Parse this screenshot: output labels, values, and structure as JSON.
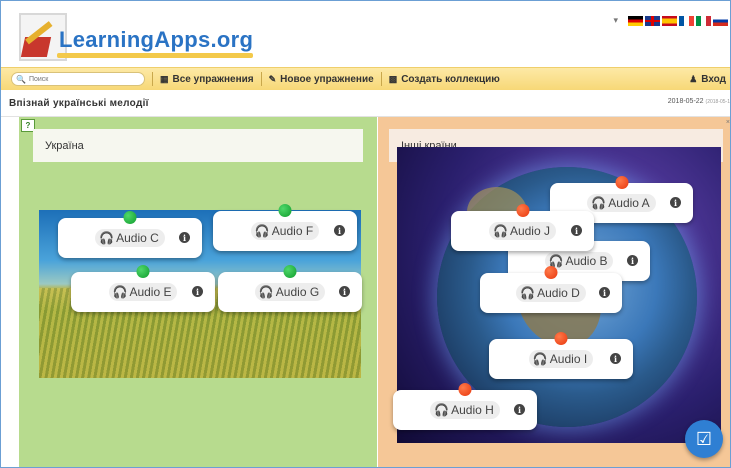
{
  "app": {
    "logo_text": "LearningApps.org",
    "lang_arrow": "▾",
    "languages": [
      "de",
      "gb",
      "es",
      "fr",
      "it",
      "ru"
    ]
  },
  "nav": {
    "search_placeholder": "Поиск",
    "all_exercises": "Все упражнения",
    "new_exercise": "Новое упражнение",
    "create_collection": "Создать коллекцию",
    "login": "Вход"
  },
  "page": {
    "title": "Впізнай українські мелодії",
    "date": "2018-05-22",
    "date_small": "(2018-05-1"
  },
  "categories": {
    "left": "Україна",
    "right": "Інші країни"
  },
  "cards": [
    {
      "label": "Audio C",
      "pin": "green"
    },
    {
      "label": "Audio F",
      "pin": "green"
    },
    {
      "label": "Audio E",
      "pin": "green"
    },
    {
      "label": "Audio G",
      "pin": "green"
    },
    {
      "label": "Audio A",
      "pin": "red"
    },
    {
      "label": "Audio J",
      "pin": "red"
    },
    {
      "label": "Audio B",
      "pin": "none"
    },
    {
      "label": "Audio D",
      "pin": "red"
    },
    {
      "label": "Audio I",
      "pin": "red"
    },
    {
      "label": "Audio H",
      "pin": "red"
    }
  ],
  "colors": {
    "left_panel": "#b7db8e",
    "right_panel": "#f5c797",
    "pin_green": "#1aa83a",
    "pin_red": "#f24b1a",
    "check_button": "#2f7fd3",
    "logo_blue": "#2a73c4"
  },
  "icons": {
    "help": "help-icon",
    "headphones": "headphones-icon",
    "info": "info-icon",
    "check": "check-icon"
  }
}
